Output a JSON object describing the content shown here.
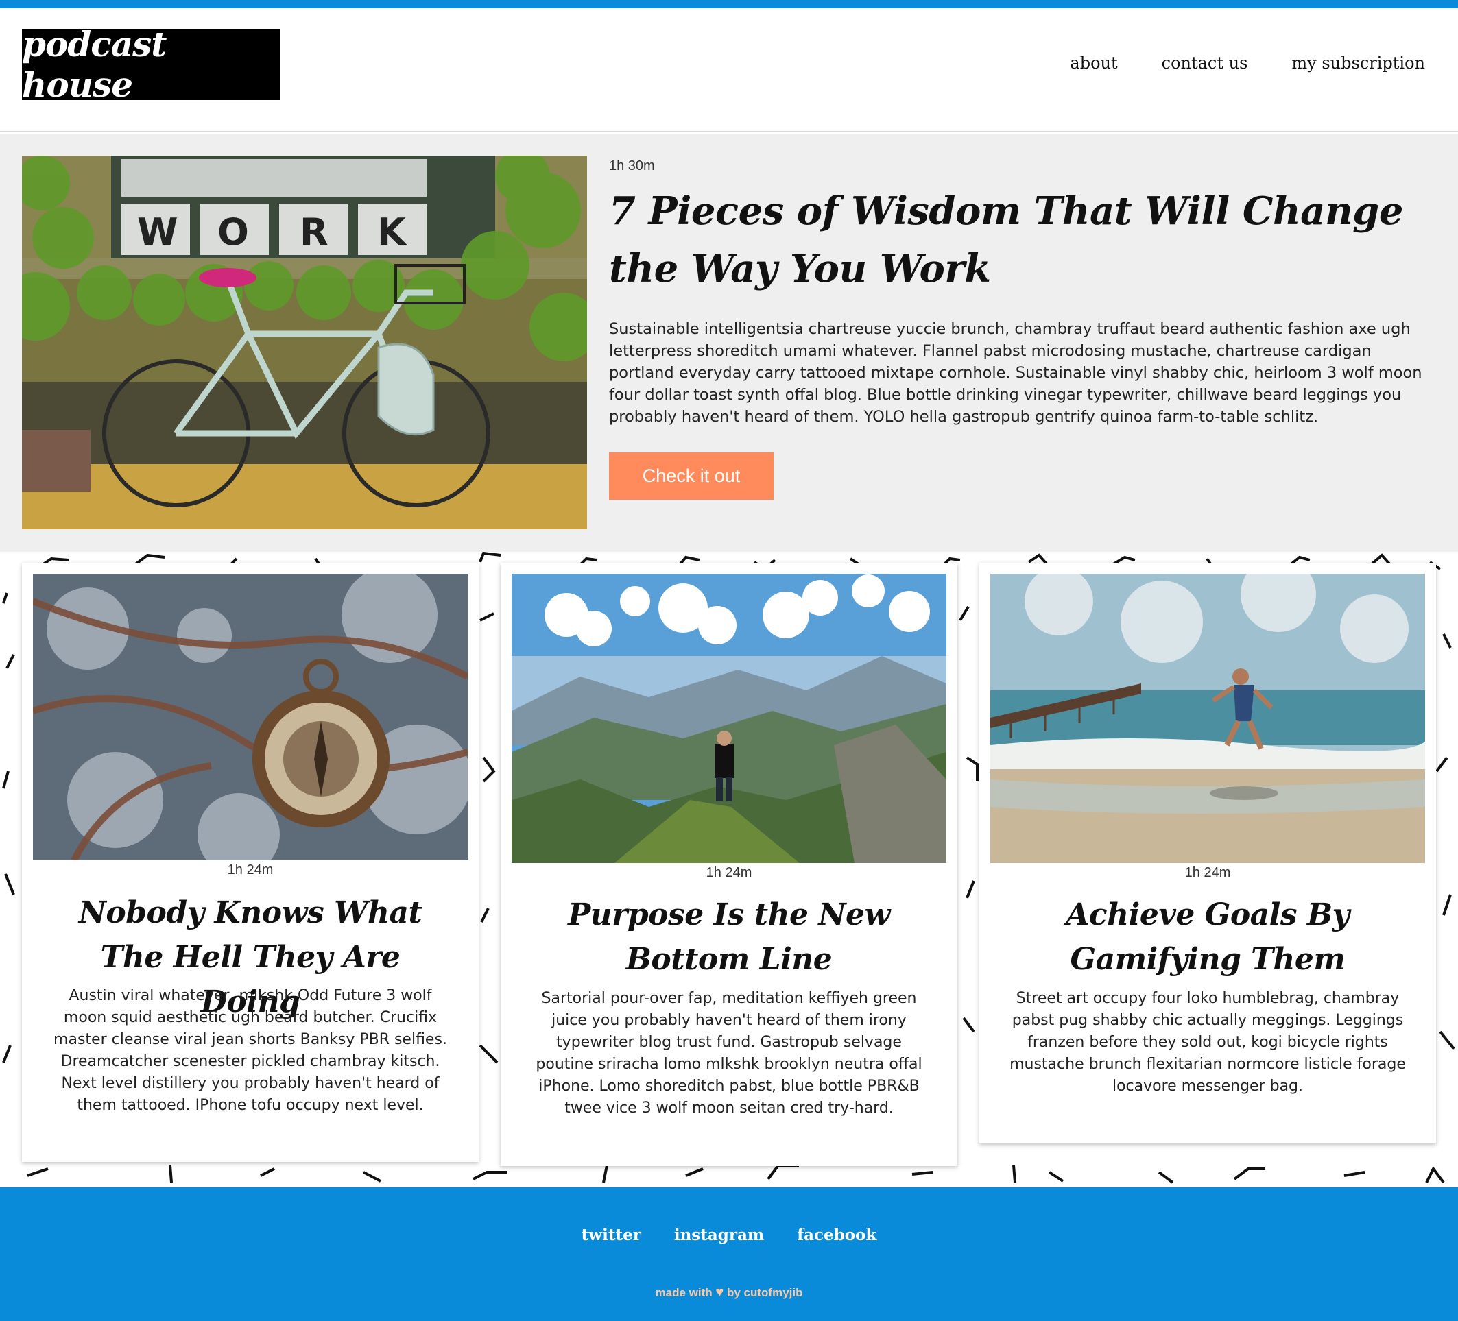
{
  "header": {
    "logo_text": "podcast house",
    "nav": [
      {
        "label": "about"
      },
      {
        "label": "contact us"
      },
      {
        "label": "my subscription"
      }
    ]
  },
  "featured": {
    "duration": "1h 30m",
    "title": "7 Pieces of Wisdom That Will Change the Way You Work",
    "description": "Sustainable intelligentsia chartreuse yuccie brunch, chambray truffaut beard authentic fashion axe ugh letterpress shoreditch umami whatever. Flannel pabst microdosing mustache, chartreuse cardigan portland everyday carry tattooed mixtape cornhole. Sustainable vinyl shabby chic, heirloom 3 wolf moon four dollar toast synth offal blog. Blue bottle drinking vinegar typewriter, chillwave beard leggings you probably haven't heard of them. YOLO hella gastropub gentrify quinoa farm-to-table schlitz.",
    "cta_label": "Check it out",
    "image_sign_text": "WORK"
  },
  "cards": [
    {
      "duration": "1h 24m",
      "title": "Nobody Knows What The Hell They Are Doing",
      "description": "Austin viral whatever, mlkshk Odd Future 3 wolf moon squid aesthetic ugh beard butcher. Crucifix master cleanse viral jean shorts Banksy PBR selfies. Dreamcatcher scenester pickled chambray kitsch. Next level distillery you probably haven't heard of them tattooed. IPhone tofu occupy next level."
    },
    {
      "duration": "1h 24m",
      "title": "Purpose Is the New Bottom Line",
      "description": "Sartorial pour-over fap, meditation keffiyeh green juice you probably haven't heard of them irony typewriter blog trust fund. Gastropub selvage poutine sriracha lomo mlkshk brooklyn neutra offal iPhone. Lomo shoreditch pabst, blue bottle PBR&B twee vice 3 wolf moon seitan cred try-hard."
    },
    {
      "duration": "1h 24m",
      "title": "Achieve Goals By Gamifying Them",
      "description": "Street art occupy four loko humblebrag, chambray pabst pug shabby chic actually meggings. Leggings franzen before they sold out, kogi bicycle rights mustache brunch flexitarian normcore listicle forage locavore messenger bag."
    }
  ],
  "footer": {
    "social": [
      {
        "label": "twitter"
      },
      {
        "label": "instagram"
      },
      {
        "label": "facebook"
      }
    ],
    "credit_prefix": "made with",
    "credit_icon": "heart-icon",
    "credit_suffix": "by cutofmyjib"
  },
  "colors": {
    "brand_blue": "#0a8bd9",
    "cta_orange": "#ff8a5c",
    "featured_bg": "#efefef"
  }
}
